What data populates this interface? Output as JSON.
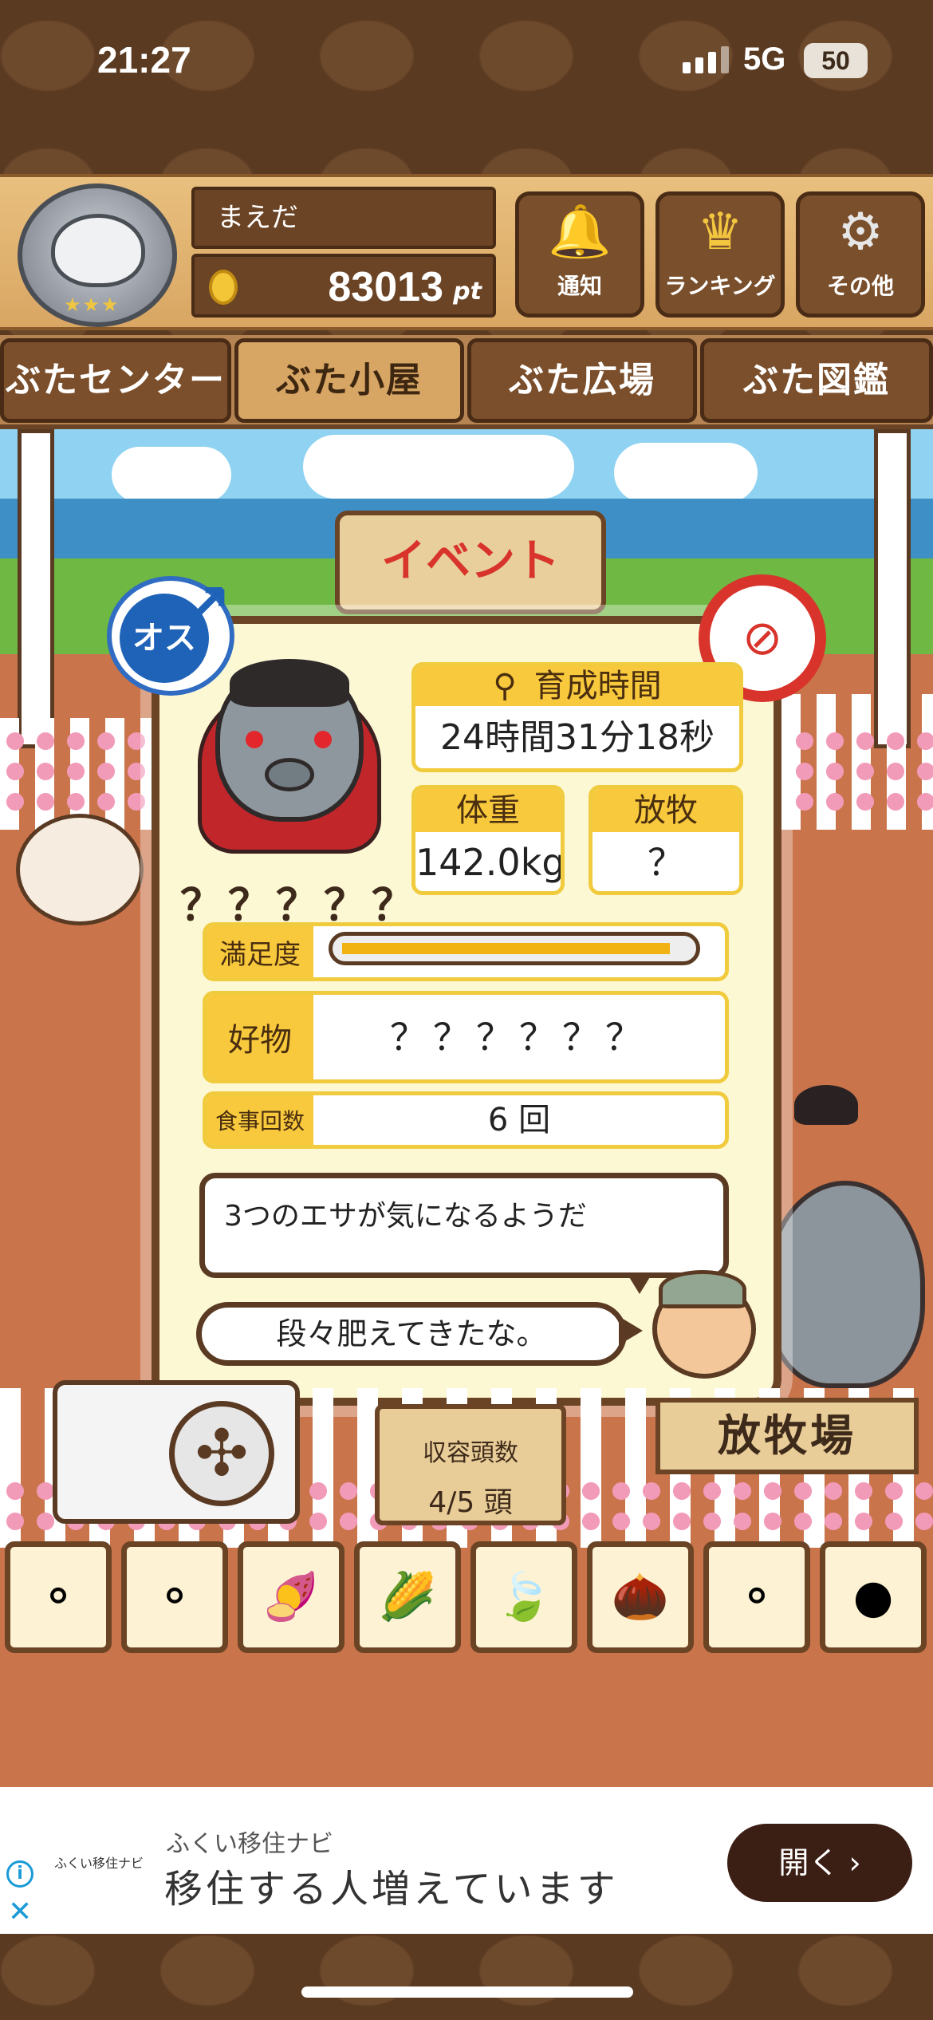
{
  "status_bar": {
    "time": "21:27",
    "network": "5G",
    "battery": "50"
  },
  "header": {
    "user_name": "まえだ",
    "points": "83013",
    "points_unit": "pt",
    "buttons": [
      {
        "label": "通知",
        "icon": "bell-icon"
      },
      {
        "label": "ランキング",
        "icon": "crown-icon"
      },
      {
        "label": "その他",
        "icon": "gear-icon"
      }
    ]
  },
  "tabs": [
    "ぶたセンター",
    "ぶた小屋",
    "ぶた広場",
    "ぶた図鑑"
  ],
  "scene": {
    "event_sign": "イベント"
  },
  "pig_status": {
    "gender_badge": "オス",
    "name": "？？？？？",
    "growth_time_label": "育成時間",
    "growth_time_value": "24時間31分18秒",
    "weight_label": "体重",
    "weight_value": "142.0kg",
    "graze_label": "放牧",
    "graze_value": "？",
    "satisfaction_label": "満足度",
    "satisfaction_level": 0.93,
    "favorite_label": "好物",
    "favorite_value": "？？？？？？",
    "meals_label": "食事回数",
    "meals_value": "6 回",
    "message_1": "3つのエサが気になるようだ",
    "message_2": "段々肥えてきたな。"
  },
  "bottom": {
    "capacity_label": "収容頭数",
    "capacity_value": "4/5 頭",
    "graze_sign": "放牧場"
  },
  "ad": {
    "logo_text": "ふくい移住ナビ",
    "subtitle": "ふくい移住ナビ",
    "title": "移住する人増えています",
    "button": "開く"
  },
  "colors": {
    "wood": "#6b4426",
    "accent_yellow": "#f8c93c",
    "panel_bg": "#fdf8d4",
    "male_blue": "#1f63b8"
  }
}
